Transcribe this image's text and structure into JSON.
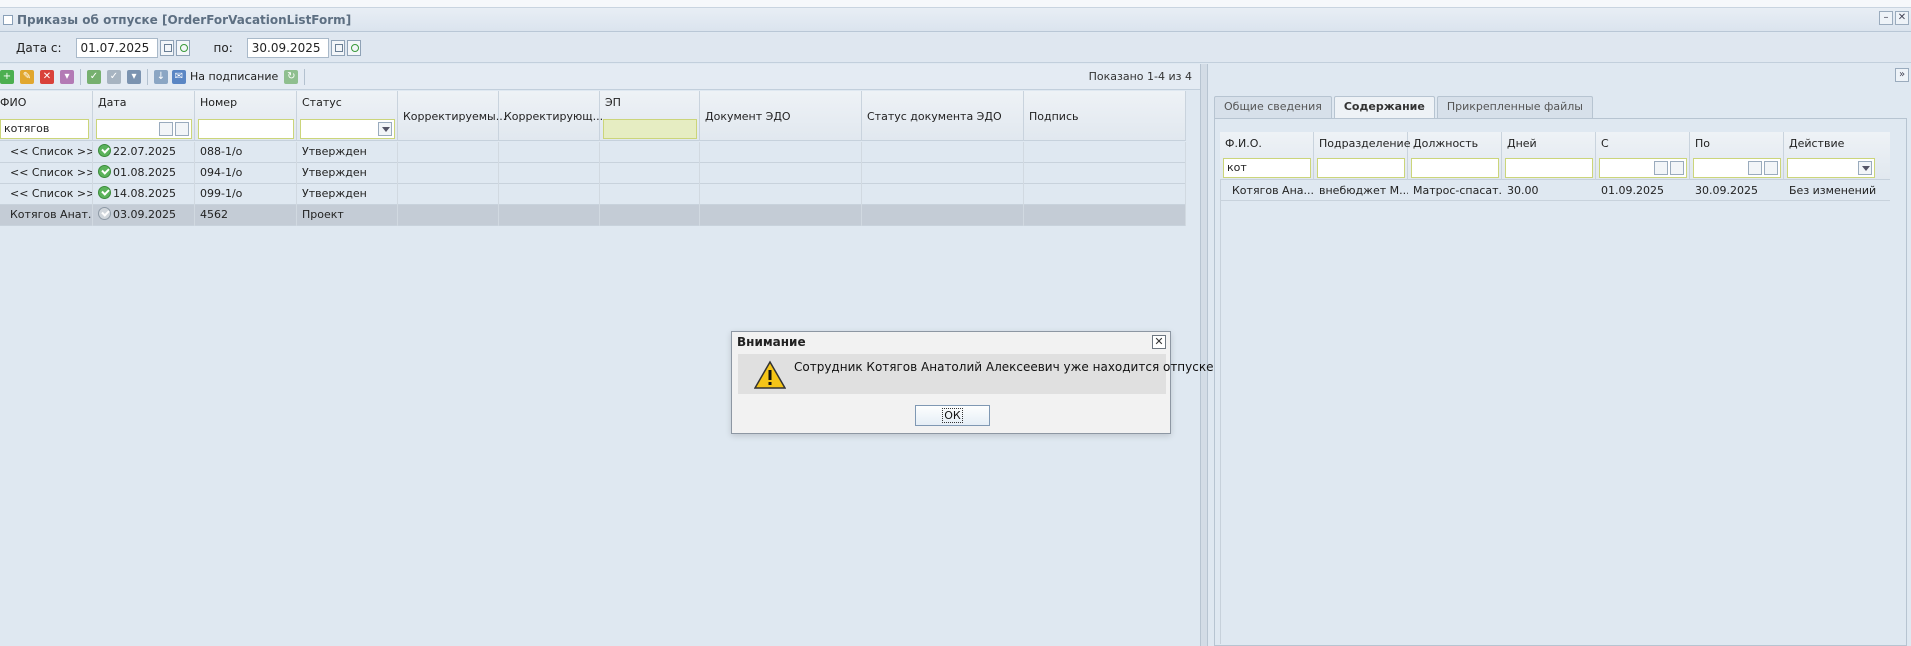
{
  "window": {
    "title": "Приказы об отпуске [OrderForVacationListForm]"
  },
  "filters": {
    "date_from_label": "Дата с:",
    "date_from": "01.07.2025",
    "date_to_label": "по:",
    "date_to": "30.09.2025"
  },
  "toolbar": {
    "sign_label": "На подписание",
    "shown": "Показано 1-4 из 4"
  },
  "grid": {
    "columns": [
      "ФИО",
      "Дата",
      "Номер",
      "Статус",
      "Корректируемы...",
      "Корректирующ...",
      "ЭП",
      "Документ ЭДО",
      "Статус документа ЭДО",
      "Подпись"
    ],
    "filter_fio": "котягов",
    "rows": [
      {
        "fio": "<< Список >>",
        "date": "22.07.2025",
        "number": "088-1/о",
        "status": "Утвержден"
      },
      {
        "fio": "<< Список >>",
        "date": "01.08.2025",
        "number": "094-1/о",
        "status": "Утвержден"
      },
      {
        "fio": "<< Список >>",
        "date": "14.08.2025",
        "number": "099-1/о",
        "status": "Утвержден"
      },
      {
        "fio": "Котягов Анат...",
        "date": "03.09.2025",
        "number": "4562",
        "status": "Проект"
      }
    ]
  },
  "right": {
    "tabs": [
      "Общие сведения",
      "Содержание",
      "Прикрепленные файлы"
    ],
    "columns": [
      "Ф.И.О.",
      "Подразделение",
      "Должность",
      "Дней",
      "С",
      "По",
      "Действие"
    ],
    "filter_fio": "кот",
    "row": {
      "fio": "Котягов Ана...",
      "dept": "внебюджет М...",
      "position": "Матрос-спасат...",
      "days": "30.00",
      "from": "01.09.2025",
      "to": "30.09.2025",
      "action": "Без изменений"
    }
  },
  "modal": {
    "title": "Внимание",
    "message": "Сотрудник Котягов Анатолий Алексеевич уже находится отпуске",
    "ok": "ОК",
    "close": "✕"
  },
  "colors": {
    "accent": "#cbd57a",
    "selected_row": "#c4ccd6",
    "panel_bg": "#dfe8f1"
  }
}
